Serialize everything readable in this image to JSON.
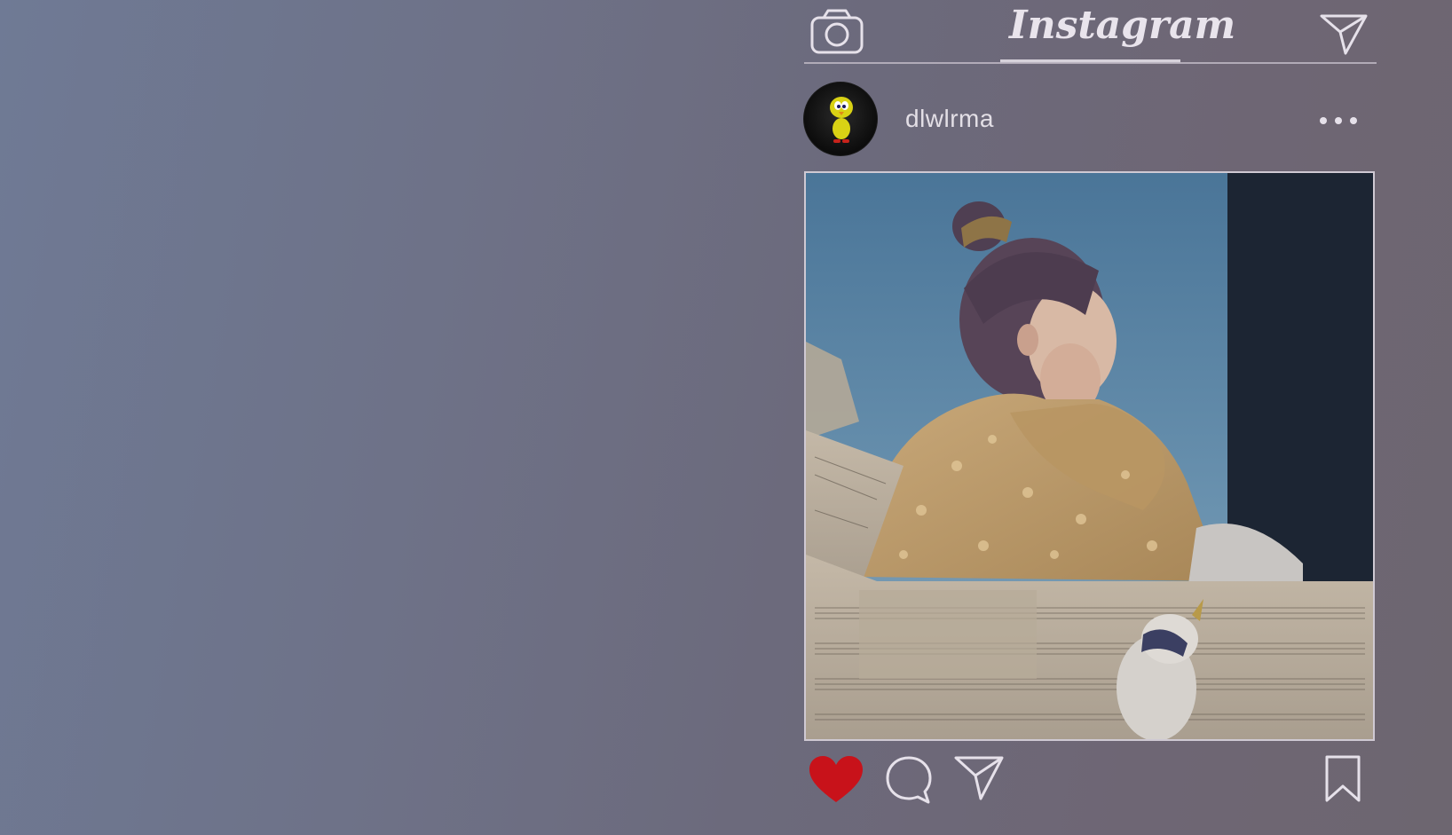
{
  "header": {
    "brand": "Instagram",
    "camera_icon": "camera-icon",
    "direct_icon": "paper-plane-icon"
  },
  "post": {
    "username": "dlwlrma",
    "avatar_icon": "tweety-bird-avatar",
    "more_icon": "more-dots-icon",
    "photo_description_icon": "post-photo"
  },
  "actions": {
    "like_icon": "heart-icon",
    "liked": true,
    "comment_icon": "comment-icon",
    "share_icon": "paper-plane-icon",
    "save_icon": "bookmark-icon"
  },
  "colors": {
    "heart": "#c8121a",
    "chrome": "#e6e1ea"
  }
}
